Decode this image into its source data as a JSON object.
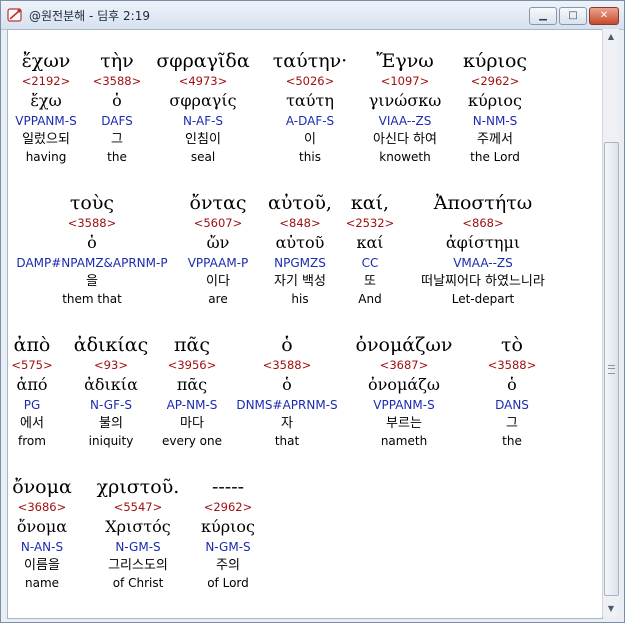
{
  "window": {
    "title": "@원전분해 - 딤후 2:19",
    "min_label": "▁",
    "max_label": "□",
    "close_label": "✕"
  },
  "rows": [
    [
      {
        "greek": "ἔχων",
        "strong": "<2192>",
        "lemma": "ἔχω",
        "parse": "VPPANM-S",
        "korean": "일렀으되",
        "english": "having"
      },
      {
        "greek": "τὴν",
        "strong": "<3588>",
        "lemma": "ὁ",
        "parse": "DAFS",
        "korean": "그",
        "english": "the"
      },
      {
        "greek": "σφραγῖδα",
        "strong": "<4973>",
        "lemma": "σφραγίς",
        "parse": "N-AF-S",
        "korean": "인침이",
        "english": "seal"
      },
      {
        "greek": "ταύτην·",
        "strong": "<5026>",
        "lemma": "ταύτη",
        "parse": "A-DAF-S",
        "korean": "이",
        "english": "this"
      },
      {
        "greek": "Ἔγνω",
        "strong": "<1097>",
        "lemma": "γινώσκω",
        "parse": "VIAA--ZS",
        "korean": "아신다 하여",
        "english": "knoweth"
      },
      {
        "greek": "κύριος",
        "strong": "<2962>",
        "lemma": "κύριος",
        "parse": "N-NM-S",
        "korean": "주께서",
        "english": "the Lord"
      }
    ],
    [
      {
        "greek": "τοὺς",
        "strong": "<3588>",
        "lemma": "ὁ",
        "parse": "DAMP#NPAMZ&APRNM-P",
        "korean": "을",
        "english": "them that"
      },
      {
        "greek": "ὄντας",
        "strong": "<5607>",
        "lemma": "ὤν",
        "parse": "VPPAAM-P",
        "korean": "이다",
        "english": "are"
      },
      {
        "greek": "αὐτοῦ,",
        "strong": "<848>",
        "lemma": "αὐτοῦ",
        "parse": "NPGMZS",
        "korean": "자기 백성",
        "english": "his"
      },
      {
        "greek": "καί,",
        "strong": "<2532>",
        "lemma": "καί",
        "parse": "CC",
        "korean": "또",
        "english": "And"
      },
      {
        "greek": "Ἀποστήτω",
        "strong": "<868>",
        "lemma": "ἀφίστημι",
        "parse": "VMAA--ZS",
        "korean": "떠날찌어다 하였느니라",
        "english": "Let-depart"
      }
    ],
    [
      {
        "greek": "ἀπὸ",
        "strong": "<575>",
        "lemma": "ἀπό",
        "parse": "PG",
        "korean": "에서",
        "english": "from"
      },
      {
        "greek": "ἀδικίας",
        "strong": "<93>",
        "lemma": "ἀδικία",
        "parse": "N-GF-S",
        "korean": "불의",
        "english": "iniquity"
      },
      {
        "greek": "πᾶς",
        "strong": "<3956>",
        "lemma": "πᾶς",
        "parse": "AP-NM-S",
        "korean": "마다",
        "english": "every one"
      },
      {
        "greek": "ὁ",
        "strong": "<3588>",
        "lemma": "ὁ",
        "parse": "DNMS#APRNM-S",
        "korean": "자",
        "english": "that"
      },
      {
        "greek": "ὀνομάζων",
        "strong": "<3687>",
        "lemma": "ὀνομάζω",
        "parse": "VPPANM-S",
        "korean": "부르는",
        "english": "nameth"
      },
      {
        "greek": "τὸ",
        "strong": "<3588>",
        "lemma": "ὁ",
        "parse": "DANS",
        "korean": "그",
        "english": "the"
      }
    ],
    [
      {
        "greek": "ὄνομα",
        "strong": "<3686>",
        "lemma": "ὄνομα",
        "parse": "N-AN-S",
        "korean": "이름을",
        "english": "name"
      },
      {
        "greek": "χριστοῦ.",
        "strong": "<5547>",
        "lemma": "Χριστός",
        "parse": "N-GM-S",
        "korean": "그리스도의",
        "english": "of Christ"
      },
      {
        "greek": "-----",
        "strong": "<2962>",
        "lemma": "κύριος",
        "parse": "N-GM-S",
        "korean": "주의",
        "english": "of Lord"
      }
    ]
  ]
}
